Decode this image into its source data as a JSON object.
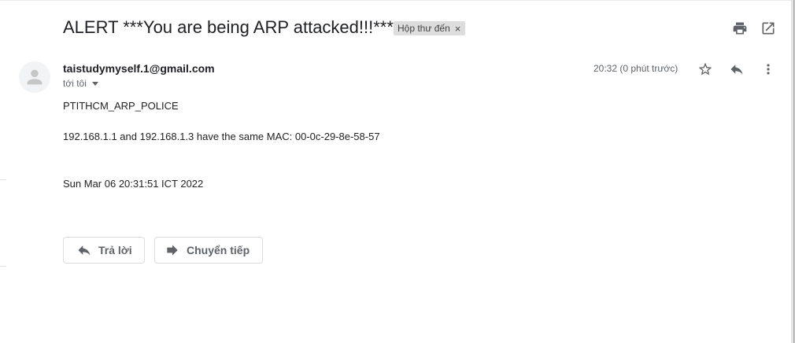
{
  "email": {
    "subject": "ALERT ***You are being ARP attacked!!!***",
    "label": "Hộp thư đến",
    "label_close": "×",
    "sender": "taistudymyself.1@gmail.com",
    "recipient": "tới tôi",
    "time": "20:32 (0 phút trước)",
    "body": [
      "PTITHCM_ARP_POLICE",
      "192.168.1.1 and 192.168.1.3 have the same MAC: 00-0c-29-8e-58-57",
      "Sun Mar 06 20:31:51 ICT 2022"
    ]
  },
  "actions": {
    "reply_label": "Trả lời",
    "forward_label": "Chuyển tiếp"
  },
  "icons": {
    "print": "print-icon",
    "open_new_window": "open-in-new-icon",
    "star": "star-outline-icon",
    "reply": "reply-icon",
    "more": "more-vert-icon",
    "forward": "forward-icon",
    "avatar": "person-icon"
  },
  "colors": {
    "text_primary": "#202124",
    "text_secondary": "#5f6368",
    "chip_background": "#dddddd",
    "border": "#dadce0"
  }
}
